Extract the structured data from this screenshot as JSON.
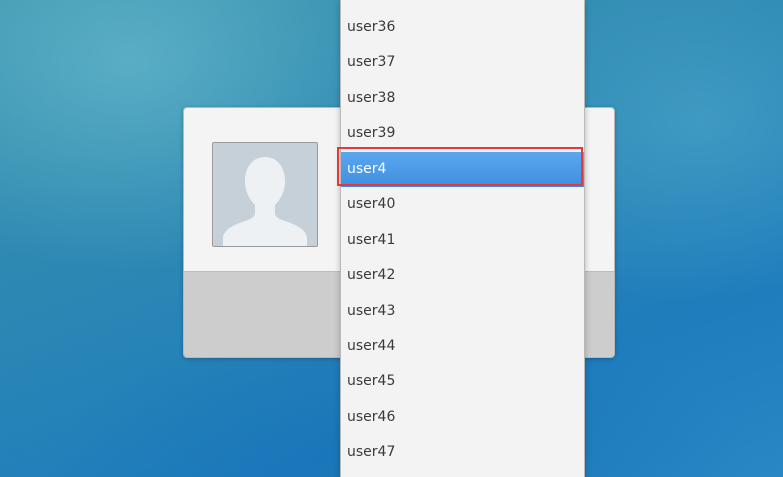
{
  "greeter": {
    "avatar_icon": "user-silhouette-icon"
  },
  "user_list": {
    "items": [
      {
        "label": "user36"
      },
      {
        "label": "user37"
      },
      {
        "label": "user38"
      },
      {
        "label": "user39"
      },
      {
        "label": "user4",
        "selected": true
      },
      {
        "label": "user40"
      },
      {
        "label": "user41"
      },
      {
        "label": "user42"
      },
      {
        "label": "user43"
      },
      {
        "label": "user44"
      },
      {
        "label": "user45"
      },
      {
        "label": "user46"
      },
      {
        "label": "user47"
      }
    ]
  },
  "colors": {
    "selection": "#4a9be8",
    "highlight_border": "#e23a3a",
    "panel_bg": "#f4f4f4",
    "panel_footer": "#cdcdcd"
  }
}
